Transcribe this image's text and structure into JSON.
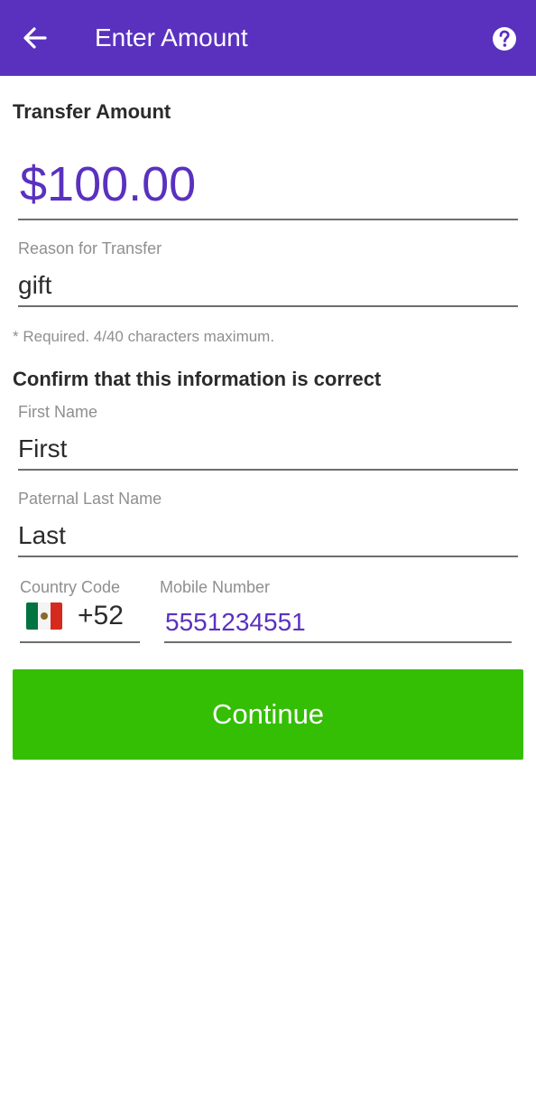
{
  "header": {
    "title": "Enter Amount",
    "back_icon": "arrow-left-icon",
    "help_icon": "question-circle-icon",
    "background_color": "#5a31bf"
  },
  "transfer": {
    "heading": "Transfer Amount",
    "amount": "$100.00",
    "reason_label": "Reason for Transfer",
    "reason_value": "gift",
    "helper_text": "* Required. 4/40 characters maximum."
  },
  "confirm": {
    "heading": "Confirm that this information is correct",
    "first_name_label": "First Name",
    "first_name_value": "First",
    "last_name_label": "Paternal Last Name",
    "last_name_value": "Last",
    "country_code_label": "Country Code",
    "country_flag": "mexico-flag-icon",
    "country_code_value": "+52",
    "mobile_label": "Mobile Number",
    "mobile_value": "5551234551"
  },
  "actions": {
    "continue_label": "Continue",
    "continue_color": "#34be04"
  },
  "colors": {
    "accent": "#5a31bf",
    "label": "#8f8f8f",
    "text": "#2b2b2b"
  }
}
